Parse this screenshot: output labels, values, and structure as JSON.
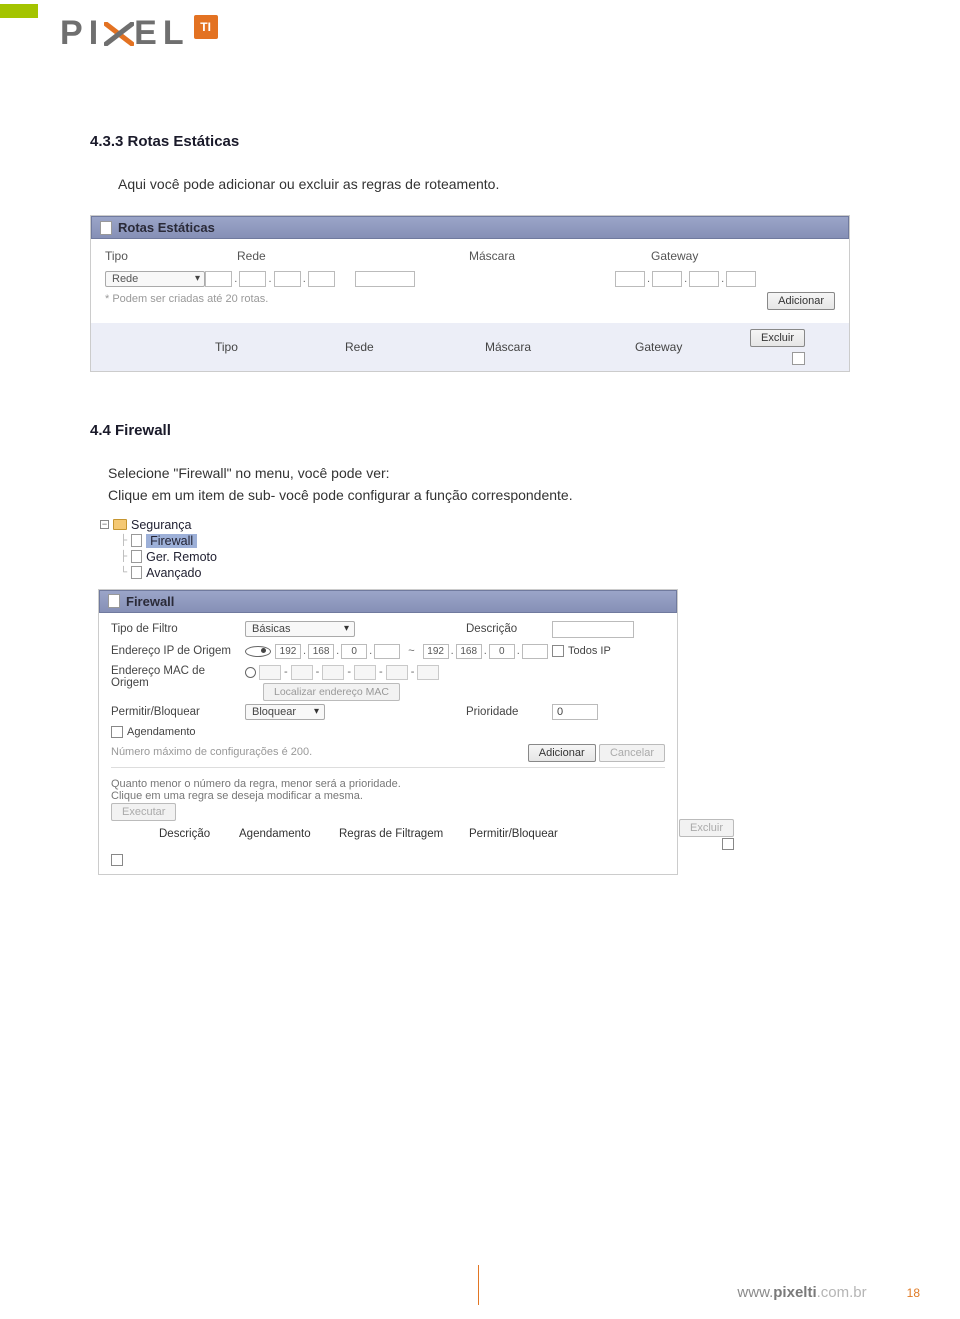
{
  "logo": {
    "text": "PIXEL",
    "badge": "TI"
  },
  "section433": {
    "title": "4.3.3 Rotas Estáticas",
    "intro": "Aqui você pode adicionar ou excluir as regras de roteamento."
  },
  "rotas": {
    "panel_title": "Rotas Estáticas",
    "cols": {
      "tipo": "Tipo",
      "rede": "Rede",
      "mascara": "Máscara",
      "gateway": "Gateway"
    },
    "type_select": "Rede",
    "hint": "* Podem ser criadas até 20 rotas.",
    "add_btn": "Adicionar",
    "del_btn": "Excluir",
    "list_cols": {
      "tipo": "Tipo",
      "rede": "Rede",
      "mascara": "Máscara",
      "gateway": "Gateway"
    }
  },
  "section44": {
    "title": "4.4 Firewall",
    "line1": "Selecione \"Firewall\" no menu, você pode ver:",
    "line2": "Clique em um item de sub- você pode configurar a função correspondente."
  },
  "tree": {
    "root": "Segurança",
    "items": [
      "Firewall",
      "Ger. Remoto",
      "Avançado"
    ],
    "selected_index": 0
  },
  "fw": {
    "panel_title": "Firewall",
    "labels": {
      "tipo_filtro": "Tipo de Filtro",
      "descricao": "Descrição",
      "ip_origem": "Endereço IP de Origem",
      "mac_origem": "Endereço MAC de Origem",
      "perm_bloq": "Permitir/Bloquear",
      "prioridade": "Prioridade",
      "agendamento": "Agendamento",
      "todos_ip": "Todos IP",
      "localizar_mac": "Localizar endereço MAC"
    },
    "tipo_filtro_value": "Básicas",
    "perm_bloq_value": "Bloquear",
    "prioridade_value": "0",
    "ip1": [
      "192",
      "168",
      "0",
      ""
    ],
    "ip2": [
      "192",
      "168",
      "0",
      ""
    ],
    "max_hint": "Número máximo de configurações é 200.",
    "add_btn": "Adicionar",
    "cancel_btn": "Cancelar",
    "rule_hint1": "Quanto menor o número da regra, menor será a prioridade.",
    "rule_hint2": "Clique em uma regra se deseja modificar a mesma.",
    "exec_btn": "Executar",
    "del_btn": "Excluir",
    "table_cols": {
      "descricao": "Descrição",
      "agendamento": "Agendamento",
      "regras": "Regras de Filtragem",
      "perm": "Permitir/Bloquear"
    }
  },
  "footer": {
    "www": "www.",
    "domain": "pixelti",
    "tld": ".com.br",
    "page": "18"
  }
}
